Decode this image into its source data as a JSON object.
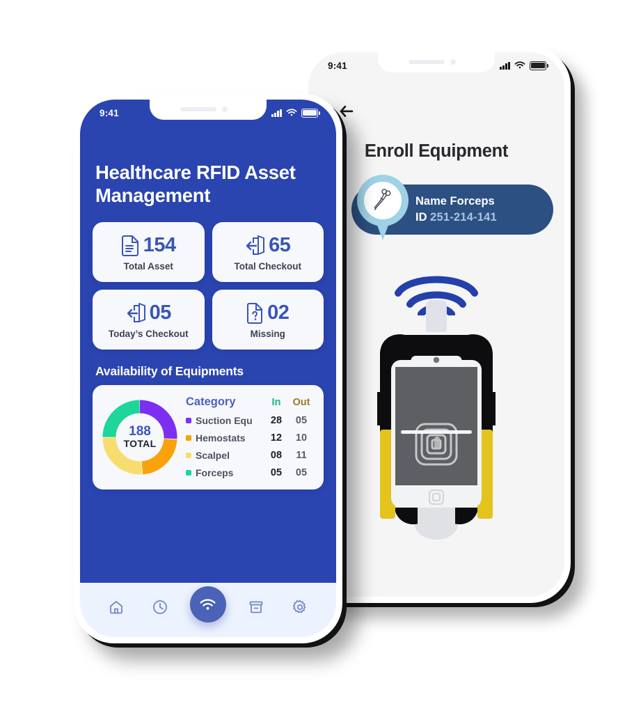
{
  "left_phone": {
    "status_bar": {
      "time": "9:41",
      "signal_icon": "cellular-bars-icon",
      "wifi_icon": "wifi-icon",
      "battery_icon": "battery-icon"
    },
    "app_title": "Healthcare RFID Asset Management",
    "stats": [
      {
        "icon": "document-icon",
        "value": "154",
        "label": "Total Asset"
      },
      {
        "icon": "checkout-door-icon",
        "value": "65",
        "label": "Total Checkout"
      },
      {
        "icon": "checkout-door-icon",
        "value": "05",
        "label": "Today’s Checkout"
      },
      {
        "icon": "document-question-icon",
        "value": "02",
        "label": "Missing"
      }
    ],
    "section_title": "Availability of Equipments",
    "chart_card": {
      "center_value": "188",
      "center_label": "TOTAL",
      "headers": {
        "category": "Category",
        "in": "In",
        "out": "Out"
      },
      "rows": [
        {
          "color": "#7c2ff0",
          "category": "Suction Equ",
          "in": "28",
          "out": "05"
        },
        {
          "color": "#f9a20b",
          "category": "Hemostats",
          "in": "12",
          "out": "10"
        },
        {
          "color": "#f7dd6e",
          "category": "Scalpel",
          "in": "08",
          "out": "11"
        },
        {
          "color": "#1ed69a",
          "category": "Forceps",
          "in": "05",
          "out": "05"
        }
      ]
    },
    "tabbar": [
      {
        "icon": "home-icon",
        "active": false
      },
      {
        "icon": "history-clock-icon",
        "active": false
      },
      {
        "icon": "wifi-scan-icon",
        "active": true
      },
      {
        "icon": "archive-box-icon",
        "active": false
      },
      {
        "icon": "gear-icon",
        "active": false
      }
    ]
  },
  "right_phone": {
    "status_bar": {
      "time": "9:41",
      "signal_icon": "cellular-bars-icon",
      "wifi_icon": "wifi-icon",
      "battery_icon": "battery-icon"
    },
    "back_icon": "back-arrow-icon",
    "page_title": "Enroll Equipment",
    "tag_card": {
      "pin_icon": "forceps-icon",
      "name_label": "Name",
      "name_value": "Forceps",
      "id_label": "ID",
      "id_value": "251-214-141"
    },
    "scanner": {
      "wifi_signal_icon": "rfid-broadcast-icon",
      "tag_icon": "rfid-tag-icon",
      "device_icon": "rugged-rfid-scanner-icon",
      "screen_icon": "nfc-scan-target-icon"
    }
  },
  "chart_data": {
    "type": "pie",
    "title": "Availability of Equipments",
    "center_value": 188,
    "center_label": "TOTAL",
    "categories": [
      "Suction Equ",
      "Hemostats",
      "Scalpel",
      "Forceps"
    ],
    "colors": [
      "#7c2ff0",
      "#f9a20b",
      "#f7dd6e",
      "#1ed69a"
    ],
    "series": [
      {
        "name": "In",
        "values": [
          28,
          12,
          8,
          5
        ]
      },
      {
        "name": "Out",
        "values": [
          5,
          10,
          11,
          5
        ]
      }
    ],
    "slice_percent": [
      26,
      23,
      26,
      25
    ],
    "legend": "right",
    "grid": false
  },
  "theme": {
    "brand_blue": "#2a44b0",
    "card_bg": "#f7f8fc",
    "accent_blue": "#3a55b8",
    "tab_bg": "#edf3fe",
    "pill_navy": "#2b5081",
    "pin_blue": "#9fd2e6",
    "scanner_yellow": "#e3c41f"
  }
}
